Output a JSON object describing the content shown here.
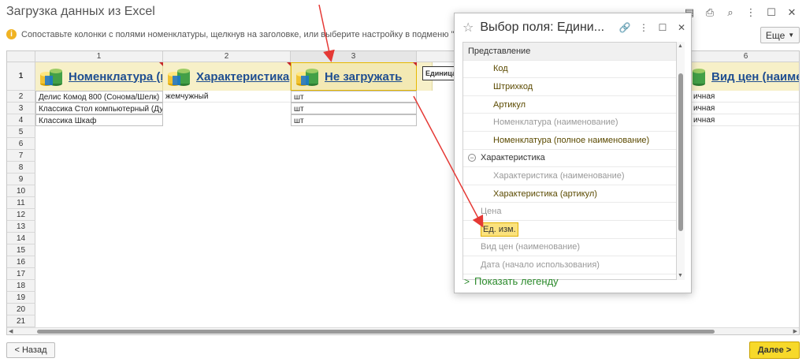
{
  "window": {
    "title": "Загрузка данных из Excel",
    "icons": [
      "save-icon",
      "print-icon",
      "search-doc-icon",
      "more-vertical-icon",
      "maximize-icon",
      "close-icon"
    ]
  },
  "hint": {
    "text": "Сопоставьте колонки с полями номенклатуры, щелкнув на заголовке, или выберите настройку в подменю \"Еще\""
  },
  "toolbar": {
    "more_label": "Еще"
  },
  "grid": {
    "column_numbers": [
      "1",
      "2",
      "3",
      "6"
    ],
    "field_headers": [
      "Номенклатура (на",
      "Характеристика",
      "Не загружать",
      "Вид цен (наиме"
    ],
    "row_numbers": [
      "1",
      "2",
      "3",
      "4",
      "5",
      "6",
      "7",
      "8",
      "9",
      "10",
      "11",
      "12",
      "13",
      "14",
      "15",
      "16",
      "17",
      "18",
      "19",
      "20",
      "21"
    ],
    "rows": [
      {
        "col1": "Делис Комод 800 (Сонома/Шелк)",
        "col2": "жемчужный",
        "col3": "шт",
        "col6": "ичная"
      },
      {
        "col1": "Классика Стол компьютерный (Дуб)",
        "col2": "",
        "col3": "шт",
        "col6": "ичная"
      },
      {
        "col1": "Классика Шкаф",
        "col2": "",
        "col3": "шт",
        "col6": "ичная"
      }
    ],
    "tooltip_text": "Единица"
  },
  "popup": {
    "title": "Выбор поля: Едини...",
    "items": [
      {
        "label": "Представление",
        "kind": "group"
      },
      {
        "label": "Код",
        "kind": "l2 active"
      },
      {
        "label": "Штрихкод",
        "kind": "l2 active"
      },
      {
        "label": "Артикул",
        "kind": "l2 active"
      },
      {
        "label": "Номенклатура (наименование)",
        "kind": "l2 dim"
      },
      {
        "label": "Номенклатура (полное наименование)",
        "kind": "l2 active"
      },
      {
        "label": "Характеристика",
        "kind": "l1g"
      },
      {
        "label": "Характеристика (наименование)",
        "kind": "l2 dim"
      },
      {
        "label": "Характеристика (артикул)",
        "kind": "l2 active"
      },
      {
        "label": "Цена",
        "kind": "l1 dim"
      },
      {
        "label": "Ед. изм.",
        "kind": "l1 sel"
      },
      {
        "label": "Вид цен (наименование)",
        "kind": "l1 dim"
      },
      {
        "label": "Дата (начало использования)",
        "kind": "l1 dim"
      }
    ],
    "legend_label": "Показать легенду"
  },
  "footer": {
    "back_label": "< Назад",
    "next_label": "Далее >"
  },
  "colors": {
    "accent": "#f7d92a",
    "link": "#1f4e91",
    "legend": "#2a8a2a",
    "annotation_arrow": "#e53935"
  }
}
